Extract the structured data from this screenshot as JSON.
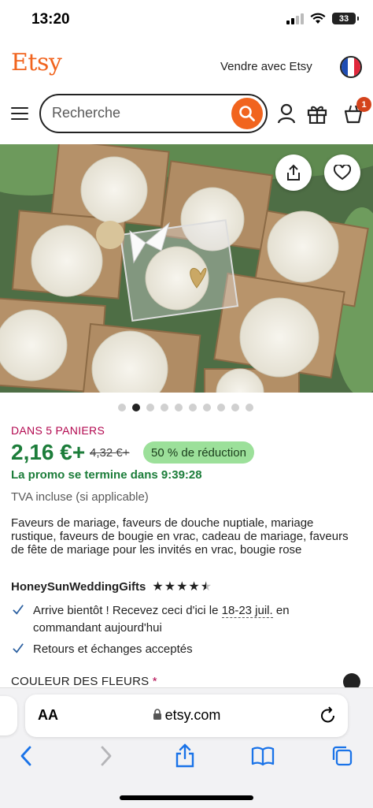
{
  "status_bar": {
    "time": "13:20",
    "battery": "33"
  },
  "header": {
    "logo": "Etsy",
    "sell_link": "Vendre avec Etsy",
    "search_placeholder": "Recherche",
    "cart_count": "1"
  },
  "gallery": {
    "image_count": 10,
    "active_index": 1
  },
  "product": {
    "in_carts": "DANS 5 PANIERS",
    "price": "2,16 €+",
    "old_price": "4,32 €+",
    "discount": "50 % de réduction",
    "promo": "La promo se termine dans 9:39:28",
    "vat": "TVA incluse (si applicable)",
    "title": "Faveurs de mariage, faveurs de douche nuptiale, mariage rustique, faveurs de bougie en vrac, cadeau de mariage, faveurs de fête de mariage pour les invités en vrac, bougie rose",
    "shop_name": "HoneySunWeddingGifts",
    "rating": 4.5,
    "arrival_prefix": "Arrive bientôt ! Recevez ceci d'ici le ",
    "arrival_dates": "18-23 juil.",
    "arrival_suffix": " en commandant aujourd'hui",
    "returns": "Retours et échanges acceptés",
    "color_label": "COULEUR DES FLEURS",
    "required_mark": "*"
  },
  "safari": {
    "text_size": "AA",
    "domain": "etsy.com"
  },
  "colors": {
    "etsy_orange": "#f1641e",
    "price_green": "#1c7d3a",
    "badge_green": "#9ce09a",
    "cart_badge": "#d4431c",
    "carts_red": "#b2064e"
  }
}
